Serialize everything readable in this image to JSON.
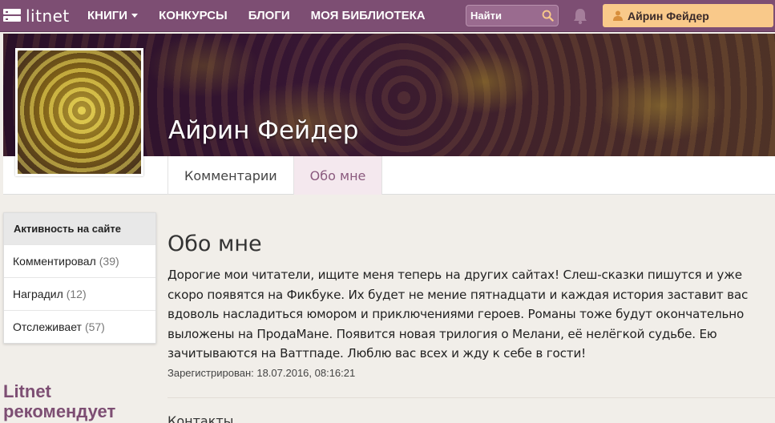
{
  "navbar": {
    "logo_text": "litnet",
    "items": [
      {
        "label": "КНИГИ",
        "has_caret": true
      },
      {
        "label": "КОНКУРСЫ"
      },
      {
        "label": "БЛОГИ"
      },
      {
        "label": "МОЯ БИБЛИОТЕКА"
      }
    ],
    "search_placeholder": "Найти",
    "user_name": "Айрин Фейдер",
    "colors": {
      "bar": "#7d4e73",
      "user_button": "#f9c98a",
      "search_icon": "#f9c98a"
    }
  },
  "profile": {
    "name": "Айрин Фейдер",
    "tabs": [
      {
        "label": "Комментарии",
        "active": false
      },
      {
        "label": "Обо мне",
        "active": true
      }
    ]
  },
  "sidebar": {
    "title": "Активность на сайте",
    "items": [
      {
        "label": "Комментировал",
        "count": "(39)"
      },
      {
        "label": "Наградил",
        "count": "(12)"
      },
      {
        "label": "Отслеживает",
        "count": "(57)"
      }
    ],
    "recommend_title": "Litnet рекомендует"
  },
  "main": {
    "about_title": "Обо мне",
    "about_text": "Дорогие мои читатели, ищите меня теперь на других сайтах! Слеш-сказки пишутся и уже скоро появятся на Фикбуке. Их будет не мение пятнадцати и каждая история заставит вас вдоволь насладиться юмором и приключениями героев. Романы тоже будут окончательно выложены на ПродаМане. Появится новая трилогия о Мелани, её нелёгкой судьбе. Ею зачитываются на Ваттпаде. Люблю вас всех и жду к себе в гости!",
    "registered": "Зарегистрирован: 18.07.2016, 08:16:21",
    "contacts_title": "Контакты"
  }
}
